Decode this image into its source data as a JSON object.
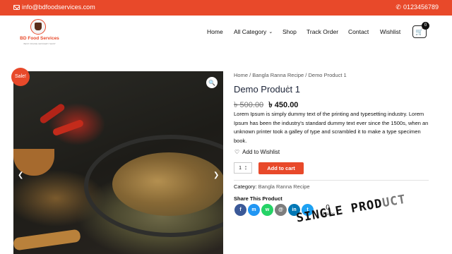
{
  "topbar": {
    "email": "info@bdfoodservices.com",
    "phone": "0123456789",
    "email_icon": "envelope-icon",
    "phone_icon": "phone-icon"
  },
  "header": {
    "logo_name": "BD Food Services",
    "logo_tagline": "BEST ONLINE GROCERY SHOP",
    "nav": {
      "home": "Home",
      "category": "All Category",
      "shop": "Shop",
      "track": "Track Order",
      "contact": "Contact",
      "wishlist": "Wishlist"
    },
    "cart_count": "0"
  },
  "gallery": {
    "sale_badge": "Sale!",
    "zoom_icon": "magnifier-icon"
  },
  "product": {
    "breadcrumb": "Home / Bangla Ranna Recipe / Demo Product 1",
    "title": "Demo Product 1",
    "old_price": "৳ 500.00",
    "new_price": "৳ 450.00",
    "description": "Lorem Ipsum is simply dummy text of the printing and typesetting industry. Lorem Ipsum has been the industry's standard dummy text ever since the 1500s, when an unknown printer took a galley of type and scrambled it to make a type specimen book.",
    "wishlist_label": "Add to Wishlist",
    "quantity": "1",
    "add_to_cart": "Add to cart",
    "category_label": "Category:",
    "category_value": "Bangla Ranna Recipe",
    "share_title": "Share This Product",
    "shares_count": "0",
    "shares_label": "Shares"
  },
  "socials": [
    {
      "name": "facebook",
      "glyph": "f",
      "color": "#3b5998"
    },
    {
      "name": "messenger",
      "glyph": "m",
      "color": "#2196f3"
    },
    {
      "name": "whatsapp",
      "glyph": "w",
      "color": "#25d366"
    },
    {
      "name": "email",
      "glyph": "@",
      "color": "#7d7d7d"
    },
    {
      "name": "linkedin",
      "glyph": "in",
      "color": "#0077b5"
    },
    {
      "name": "twitter",
      "glyph": "t",
      "color": "#1da1f2"
    }
  ],
  "overlay": {
    "text_main": "SINGLE PROD",
    "text_faint": "UCT"
  }
}
